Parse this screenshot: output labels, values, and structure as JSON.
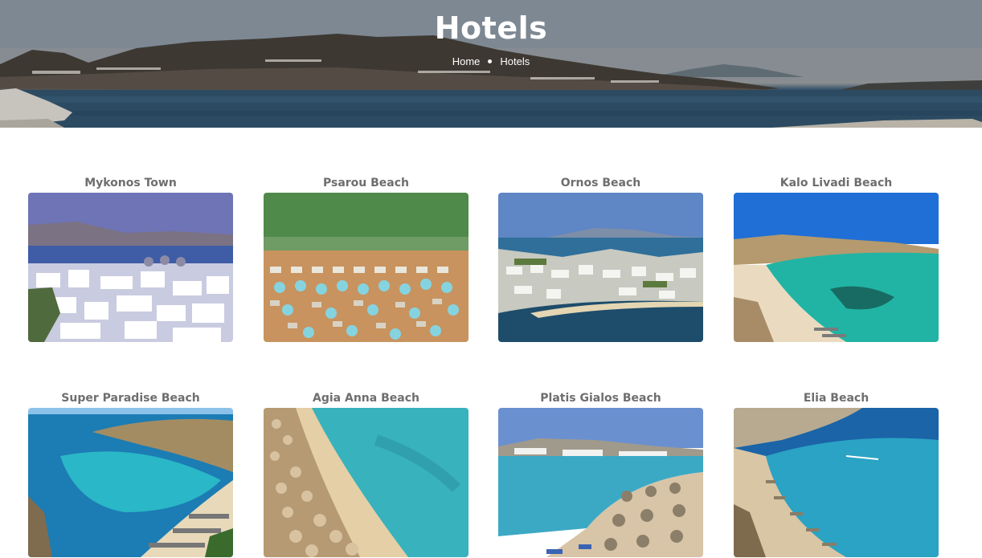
{
  "hero": {
    "title": "Hotels",
    "breadcrumb": [
      {
        "label": "Home"
      },
      {
        "label": "Hotels"
      }
    ]
  },
  "hotels": [
    {
      "name": "Mykonos Town"
    },
    {
      "name": "Psarou Beach"
    },
    {
      "name": "Ornos Beach"
    },
    {
      "name": "Kalo Livadi Beach"
    },
    {
      "name": "Super Paradise Beach"
    },
    {
      "name": "Agia Anna Beach"
    },
    {
      "name": "Platis Gialos Beach"
    },
    {
      "name": "Elia Beach"
    }
  ],
  "colors": {
    "title_text": "#6e6e6e",
    "hero_text": "#ffffff",
    "background": "#ffffff"
  }
}
